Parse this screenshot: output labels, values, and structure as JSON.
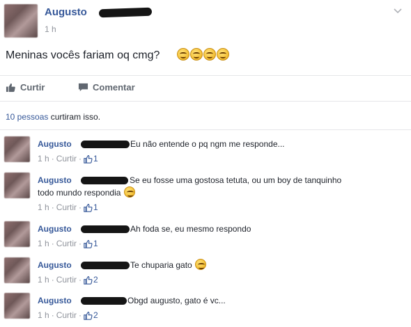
{
  "post": {
    "author": "Augusto",
    "time": "1 h",
    "text": "Meninas vocês fariam oq cmg?",
    "emoji_count": 4
  },
  "actions": {
    "like_label": "Curtir",
    "comment_label": "Comentar"
  },
  "likes_summary": {
    "link_text": "10 pessoas",
    "rest_text": " curtiram isso."
  },
  "comments": [
    {
      "author": "Augusto",
      "text": "Eu não entende o pq ngm me responde...",
      "time": "1 h",
      "like_label": "Curtir",
      "like_count": "1"
    },
    {
      "author": "Augusto",
      "text": "Se eu fosse uma gostosa tetuta, ou um boy de tanquinho",
      "text2": "todo mundo respondia",
      "time": "1 h",
      "like_label": "Curtir",
      "like_count": "1"
    },
    {
      "author": "Augusto",
      "text": "Ah foda se, eu mesmo respondo",
      "time": "1 h",
      "like_label": "Curtir",
      "like_count": "1"
    },
    {
      "author": "Augusto",
      "text": "Te chuparia gato",
      "time": "1 h",
      "like_label": "Curtir",
      "like_count": "2"
    },
    {
      "author": "Augusto",
      "text": "Obgd augusto, gato é vc...",
      "time": "1 h",
      "like_label": "Curtir",
      "like_count": "2"
    }
  ],
  "icons": {
    "chevron": "chevron-down-icon",
    "like": "thumbs-up-icon",
    "comment": "comment-bubble-icon"
  },
  "colors": {
    "link": "#365899",
    "meta": "#90949c",
    "text": "#1d2129"
  }
}
